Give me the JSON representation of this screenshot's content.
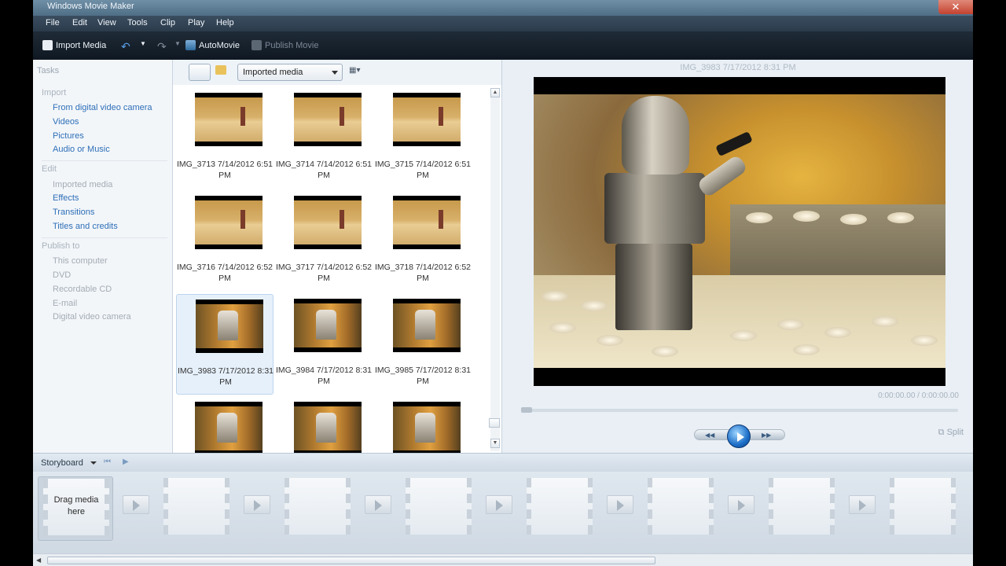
{
  "window": {
    "title": "Windows Movie Maker",
    "close": "✕"
  },
  "menu": [
    "File",
    "Edit",
    "View",
    "Tools",
    "Clip",
    "Play",
    "Help"
  ],
  "toolbar": {
    "import_media": "Import Media",
    "automovie": "AutoMovie",
    "publish_movie": "Publish Movie"
  },
  "tasks": {
    "header": "Tasks",
    "import": {
      "title": "Import",
      "links": [
        "From digital video camera",
        "Videos",
        "Pictures",
        "Audio or Music"
      ]
    },
    "edit": {
      "title": "Edit",
      "items": [
        "Imported media",
        "Effects",
        "Transitions",
        "Titles and credits"
      ]
    },
    "publish": {
      "title": "Publish to",
      "items": [
        "This computer",
        "DVD",
        "Recordable CD",
        "E-mail",
        "Digital video camera"
      ]
    }
  },
  "browser": {
    "collection": "Imported media",
    "items": [
      {
        "name": "IMG_3713 7/14/2012 6:51",
        "suffix": "PM"
      },
      {
        "name": "IMG_3714 7/14/2012 6:51",
        "suffix": "PM"
      },
      {
        "name": "IMG_3715 7/14/2012 6:51",
        "suffix": "PM"
      },
      {
        "name": "IMG_3716 7/14/2012 6:52",
        "suffix": "PM"
      },
      {
        "name": "IMG_3717 7/14/2012 6:52",
        "suffix": "PM"
      },
      {
        "name": "IMG_3718 7/14/2012 6:52",
        "suffix": "PM"
      },
      {
        "name": "IMG_3983 7/17/2012 8:31",
        "suffix": "PM"
      },
      {
        "name": "IMG_3984 7/17/2012 8:31",
        "suffix": "PM"
      },
      {
        "name": "IMG_3985 7/17/2012 8:31",
        "suffix": "PM"
      }
    ],
    "selected_index": 6
  },
  "preview": {
    "title": "IMG_3983 7/17/2012 8:31 PM",
    "timecode": "0:00:00.00 / 0:00:00.00",
    "split": "Split"
  },
  "storyboard": {
    "label": "Storyboard",
    "placeholder": "Drag media here"
  },
  "colors": {
    "link": "#2e6fb8",
    "play_button": "#1d6fc8",
    "window_bg": "#dde6ef"
  }
}
